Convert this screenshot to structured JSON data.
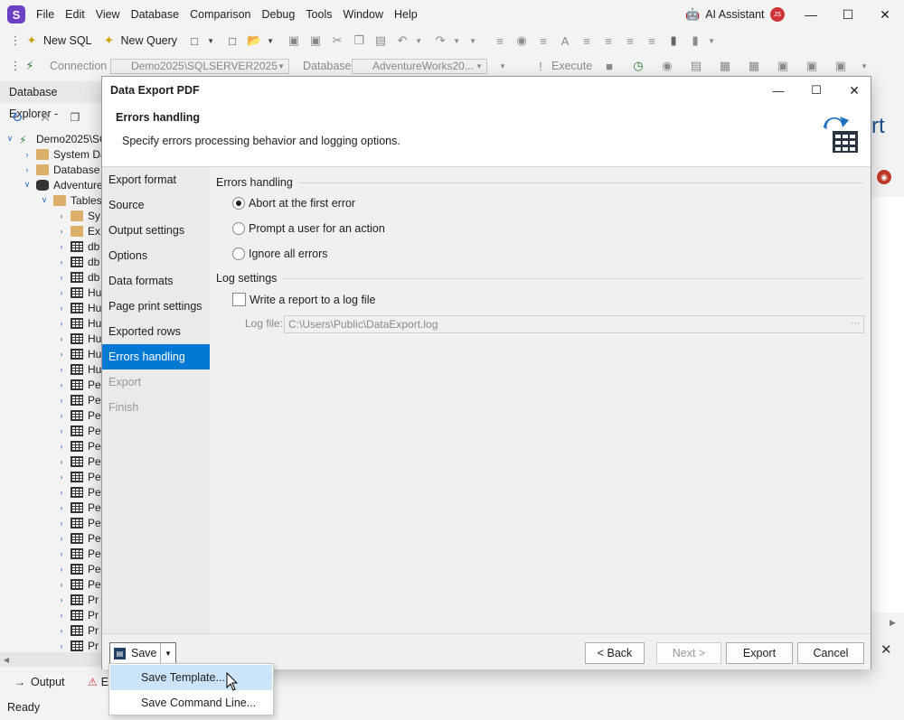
{
  "app": {
    "logo_letter": "S",
    "menu": [
      "File",
      "Edit",
      "View",
      "Database",
      "Comparison",
      "Debug",
      "Tools",
      "Window",
      "Help"
    ],
    "ai_assistant": "AI Assistant",
    "avatar_initials": "JS"
  },
  "toolbar": {
    "new_sql": "New SQL",
    "new_query": "New Query",
    "connection_label": "Connection",
    "connection_value": "Demo2025\\SQLSERVER2025",
    "database_label": "Database",
    "database_value": "AdventureWorks20...",
    "execute": "Execute"
  },
  "explorer": {
    "title": "Database Explorer -",
    "tree": [
      {
        "label": "Demo2025\\SQ",
        "level": 0,
        "icon": "server-icon",
        "expanded": true
      },
      {
        "label": "System Da",
        "level": 1,
        "icon": "folder-icon",
        "expanded": false
      },
      {
        "label": "Database",
        "level": 1,
        "icon": "folder-icon",
        "expanded": false
      },
      {
        "label": "Adventure",
        "level": 1,
        "icon": "database-icon",
        "expanded": true
      },
      {
        "label": "Tables",
        "level": 2,
        "icon": "folder-icon",
        "expanded": true
      },
      {
        "label": "Sy",
        "level": 3,
        "icon": "folder-icon",
        "expanded": false
      },
      {
        "label": "Ex",
        "level": 3,
        "icon": "folder-icon",
        "expanded": false
      },
      {
        "label": "db",
        "level": 3,
        "icon": "table-icon",
        "expanded": false
      },
      {
        "label": "db",
        "level": 3,
        "icon": "table-icon",
        "expanded": false
      },
      {
        "label": "db",
        "level": 3,
        "icon": "table-icon",
        "expanded": false
      },
      {
        "label": "Hu",
        "level": 3,
        "icon": "table-icon",
        "expanded": false
      },
      {
        "label": "Hu",
        "level": 3,
        "icon": "table-icon",
        "expanded": false
      },
      {
        "label": "Hu",
        "level": 3,
        "icon": "table-icon",
        "expanded": false
      },
      {
        "label": "Hu",
        "level": 3,
        "icon": "table-icon",
        "expanded": false
      },
      {
        "label": "Hu",
        "level": 3,
        "icon": "table-icon",
        "expanded": false
      },
      {
        "label": "Hu",
        "level": 3,
        "icon": "table-icon",
        "expanded": false
      },
      {
        "label": "Pe",
        "level": 3,
        "icon": "table-icon",
        "expanded": false
      },
      {
        "label": "Pe",
        "level": 3,
        "icon": "table-icon",
        "expanded": false
      },
      {
        "label": "Pe",
        "level": 3,
        "icon": "table-icon",
        "expanded": false
      },
      {
        "label": "Pe",
        "level": 3,
        "icon": "table-icon",
        "expanded": false
      },
      {
        "label": "Pe",
        "level": 3,
        "icon": "table-icon",
        "expanded": false
      },
      {
        "label": "Pe",
        "level": 3,
        "icon": "table-icon",
        "expanded": false
      },
      {
        "label": "Pe",
        "level": 3,
        "icon": "table-icon",
        "expanded": false
      },
      {
        "label": "Pe",
        "level": 3,
        "icon": "table-icon",
        "expanded": false
      },
      {
        "label": "Pe",
        "level": 3,
        "icon": "table-icon",
        "expanded": false
      },
      {
        "label": "Pe",
        "level": 3,
        "icon": "table-icon",
        "expanded": false
      },
      {
        "label": "Pe",
        "level": 3,
        "icon": "table-icon",
        "expanded": false
      },
      {
        "label": "Pe",
        "level": 3,
        "icon": "table-icon",
        "expanded": false
      },
      {
        "label": "Pe",
        "level": 3,
        "icon": "table-icon",
        "expanded": false
      },
      {
        "label": "Pe",
        "level": 3,
        "icon": "table-icon",
        "expanded": false
      },
      {
        "label": "Pr",
        "level": 3,
        "icon": "table-icon",
        "expanded": false
      },
      {
        "label": "Pr",
        "level": 3,
        "icon": "table-icon",
        "expanded": false
      },
      {
        "label": "Pr",
        "level": 3,
        "icon": "table-icon",
        "expanded": false
      },
      {
        "label": "Pr",
        "level": 3,
        "icon": "table-icon",
        "expanded": false
      },
      {
        "label": "Pr",
        "level": 3,
        "icon": "table-icon",
        "expanded": false
      }
    ]
  },
  "bottom_tabs": {
    "output": "Output",
    "e": "E"
  },
  "status": "Ready",
  "right_partial_text": "rt",
  "dialog": {
    "title": "Data Export PDF",
    "header_title": "Errors handling",
    "header_desc": "Specify errors processing behavior and logging options.",
    "steps": [
      {
        "label": "Export format",
        "state": "normal"
      },
      {
        "label": "Source",
        "state": "normal"
      },
      {
        "label": "Output settings",
        "state": "normal"
      },
      {
        "label": "Options",
        "state": "normal"
      },
      {
        "label": "Data formats",
        "state": "normal"
      },
      {
        "label": "Page print settings",
        "state": "normal"
      },
      {
        "label": "Exported rows",
        "state": "normal"
      },
      {
        "label": "Errors handling",
        "state": "active"
      },
      {
        "label": "Export",
        "state": "disabled"
      },
      {
        "label": "Finish",
        "state": "disabled"
      }
    ],
    "errors_group": "Errors handling",
    "options": [
      {
        "label": "Abort at the first error",
        "checked": true
      },
      {
        "label": "Prompt a user for an action",
        "checked": false
      },
      {
        "label": "Ignore all errors",
        "checked": false
      }
    ],
    "log_group": "Log settings",
    "write_report": "Write a report to a log file",
    "write_report_checked": false,
    "log_file_label": "Log file:",
    "log_file_value": "C:\\Users\\Public\\DataExport.log",
    "buttons": {
      "save": "Save",
      "back": "< Back",
      "next": "Next >",
      "export": "Export",
      "cancel": "Cancel"
    },
    "save_menu": [
      "Save Template...",
      "Save Command Line..."
    ]
  },
  "colors": {
    "accent": "#0078d4",
    "logo": "#6c3fc5",
    "menu_highlight": "#cce4f7"
  }
}
